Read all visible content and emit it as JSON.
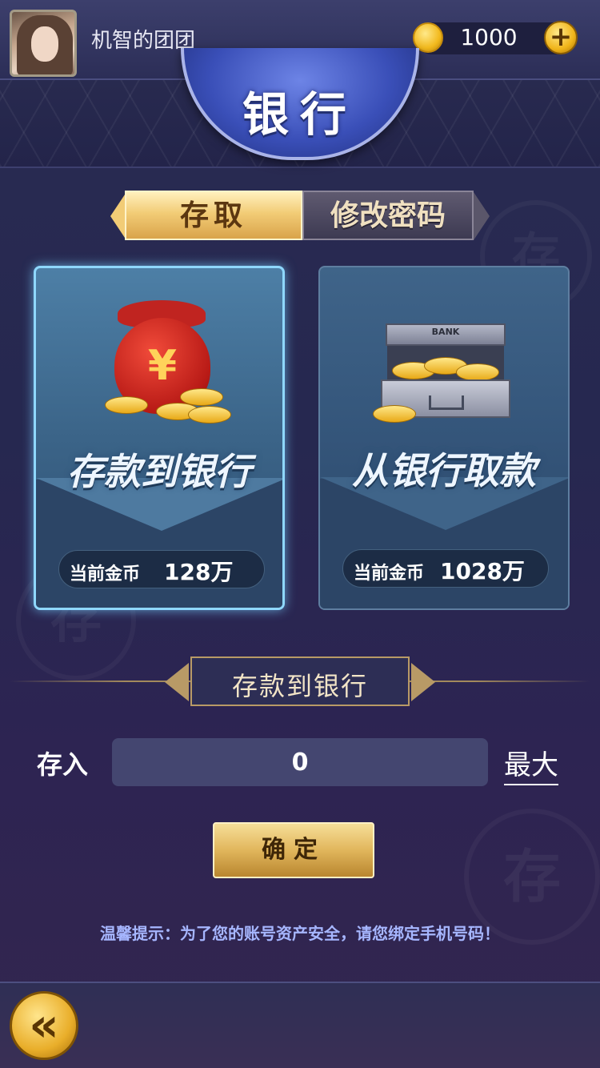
{
  "header": {
    "username": "机智的团团",
    "coins": "1000",
    "plus_icon": "+",
    "title": "银行"
  },
  "tabs": [
    {
      "label": "存取",
      "active": true
    },
    {
      "label": "修改密码",
      "active": false
    }
  ],
  "cards": {
    "deposit": {
      "title": "存款到银行",
      "balance_label": "当前金币",
      "balance_value": "128万",
      "icon": "money-bag-icon",
      "selected": true
    },
    "withdraw": {
      "title": "从银行取款",
      "balance_label": "当前金币",
      "balance_value": "1028万",
      "chest_label": "BANK",
      "icon": "bank-chest-icon",
      "selected": false
    }
  },
  "form": {
    "section_title": "存款到银行",
    "input_label": "存入",
    "input_value": "0",
    "max_label": "最大",
    "confirm_label": "确定"
  },
  "tip": "温馨提示：为了您的账号资产安全，请您绑定手机号码！",
  "footer": {
    "back_icon": "«"
  },
  "colors": {
    "accent_gold": "#e1b65c",
    "card_blue": "#3b6488",
    "tip_blue": "#a6b6ff"
  }
}
